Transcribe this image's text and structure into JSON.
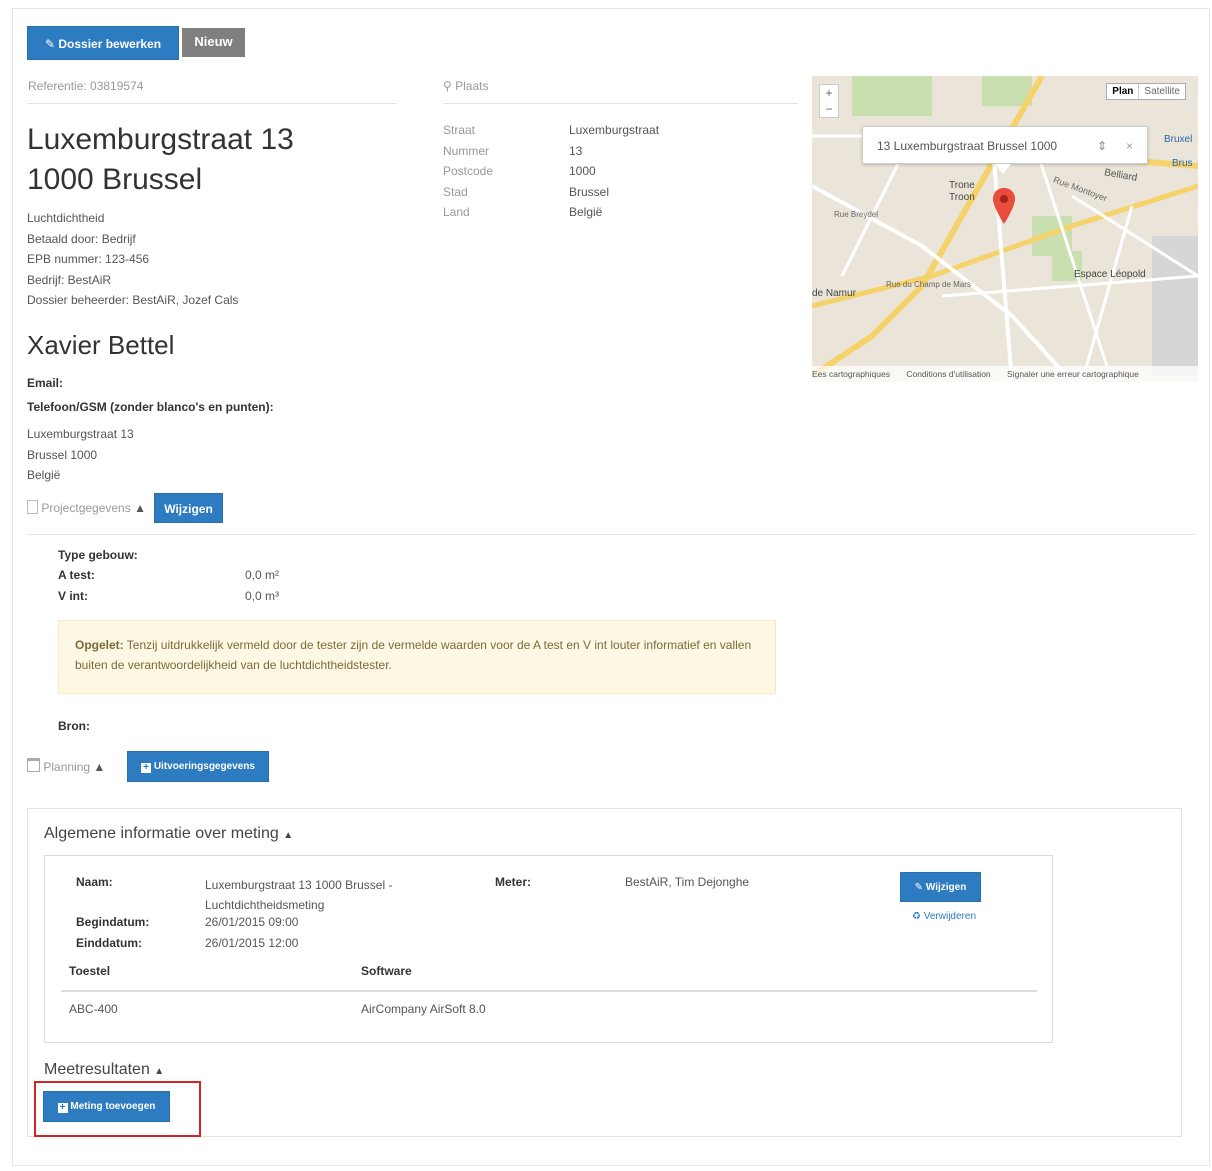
{
  "toolbar": {
    "edit_label": "Dossier bewerken",
    "new_label": "Nieuw"
  },
  "dossier": {
    "reference": "Referentie: 03819574",
    "address_line1": "Luxemburgstraat 13",
    "address_line2": "1000 Brussel",
    "info_lines": [
      "Luchtdichtheid",
      "Betaald door: Bedrijf",
      "EPB nummer: 123-456",
      "Bedrijf: BestAiR",
      "Dossier beheerder: BestAiR, Jozef Cals"
    ]
  },
  "place": {
    "header": "Plaats",
    "rows": [
      {
        "label": "Straat",
        "value": "Luxemburgstraat"
      },
      {
        "label": "Nummer",
        "value": "13"
      },
      {
        "label": "Postcode",
        "value": "1000"
      },
      {
        "label": "Stad",
        "value": "Brussel"
      },
      {
        "label": "Land",
        "value": "België"
      }
    ]
  },
  "map": {
    "popup_text": "13 Luxemburgstraat Brussel 1000",
    "plan_label": "Plan",
    "satellite_label": "Satellite",
    "footer": [
      "Ees cartographiques",
      "Conditions d'utilisation",
      "Signaler une erreur cartographique"
    ],
    "labels": [
      "Trone",
      "Troon",
      "Rue Montoyer",
      "Espace Léopold",
      "Rue du Champ de Mars",
      "de Namur",
      "Rue Breydel",
      "Bruxel",
      "Brus",
      "Belliard"
    ]
  },
  "contact": {
    "name": "Xavier Bettel",
    "email_label": "Email:",
    "phone_label": "Telefoon/GSM (zonder blanco's en punten):",
    "address": [
      "Luxemburgstraat 13",
      "Brussel 1000",
      "België"
    ]
  },
  "project": {
    "toggle_label": "Projectgegevens",
    "edit_label": "Wijzigen",
    "type_label": "Type gebouw:",
    "a_test_label": "A test:",
    "a_test_value": "0,0 m²",
    "v_int_label": "V int:",
    "v_int_value": "0,0 m³",
    "warning_title": "Opgelet:",
    "warning_text": "Tenzij uitdrukkelijk vermeld door de tester zijn de vermelde waarden voor de A test en V int louter informatief en vallen buiten de verantwoordelijkheid van de luchtdichtheidstester.",
    "source_label": "Bron:"
  },
  "planning": {
    "toggle_label": "Planning",
    "button_label": "Uitvoeringsgegevens"
  },
  "measurement": {
    "section_title": "Algemene informatie over meting",
    "name_label": "Naam:",
    "name_value_line1": "Luxemburgstraat 13 1000 Brussel -",
    "name_value_line2": "Luchtdichtheidsmeting",
    "meter_label": "Meter:",
    "meter_value": "BestAiR, Tim Dejonghe",
    "start_label": "Begindatum:",
    "start_value": "26/01/2015 09:00",
    "end_label": "Einddatum:",
    "end_value": "26/01/2015 12:00",
    "edit_label": "Wijzigen",
    "delete_label": "Verwijderen",
    "table_headers": [
      "Toestel",
      "Software"
    ],
    "table_rows": [
      [
        "ABC-400",
        "AirCompany AirSoft 8.0"
      ]
    ]
  },
  "results": {
    "section_title": "Meetresultaten",
    "add_label": "Meting toevoegen"
  },
  "colors": {
    "primary": "#2d7bc0",
    "highlight": "#d62424",
    "warning_bg": "#fcf8e3"
  }
}
